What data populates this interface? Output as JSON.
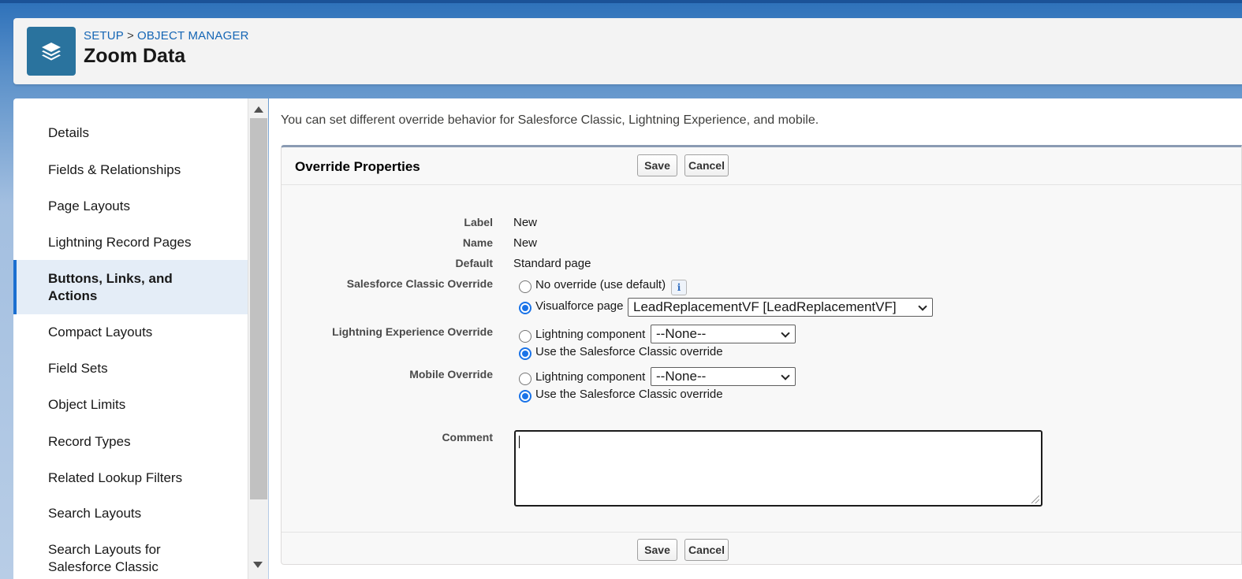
{
  "breadcrumb": {
    "setup": "SETUP",
    "separator": ">",
    "object_manager": "OBJECT MANAGER"
  },
  "page_title": "Zoom Data",
  "object_icon": "layers-icon",
  "sidebar": {
    "items": [
      {
        "label": "Details"
      },
      {
        "label": "Fields & Relationships"
      },
      {
        "label": "Page Layouts"
      },
      {
        "label": "Lightning Record Pages"
      },
      {
        "label": "Buttons, Links, and Actions",
        "active": true
      },
      {
        "label": "Compact Layouts"
      },
      {
        "label": "Field Sets"
      },
      {
        "label": "Object Limits"
      },
      {
        "label": "Record Types"
      },
      {
        "label": "Related Lookup Filters"
      },
      {
        "label": "Search Layouts"
      },
      {
        "label": "Search Layouts for Salesforce Classic"
      }
    ]
  },
  "main": {
    "intro": "You can set different override behavior for Salesforce Classic, Lightning Experience, and mobile.",
    "panel_title": "Override Properties",
    "save_label": "Save",
    "cancel_label": "Cancel",
    "fields": {
      "label_label": "Label",
      "label_value": "New",
      "name_label": "Name",
      "name_value": "New",
      "default_label": "Default",
      "default_value": "Standard page",
      "classic_label": "Salesforce Classic Override",
      "classic_opt_none": "No override (use default)",
      "classic_opt_vf": "Visualforce page",
      "classic_vf_selected": "LeadReplacementVF [LeadReplacementVF]",
      "lightning_label": "Lightning Experience Override",
      "lightning_opt_component": "Lightning component",
      "lightning_component_selected": "--None--",
      "lightning_opt_classic": "Use the Salesforce Classic override",
      "mobile_label": "Mobile Override",
      "mobile_opt_component": "Lightning component",
      "mobile_component_selected": "--None--",
      "mobile_opt_classic": "Use the Salesforce Classic override",
      "comment_label": "Comment",
      "comment_value": ""
    },
    "selected": {
      "classic": "visualforce",
      "lightning": "use-classic",
      "mobile": "use-classic"
    }
  },
  "colors": {
    "accent": "#1b6fd0",
    "brand": "#2a739e",
    "link": "#1566b5"
  }
}
